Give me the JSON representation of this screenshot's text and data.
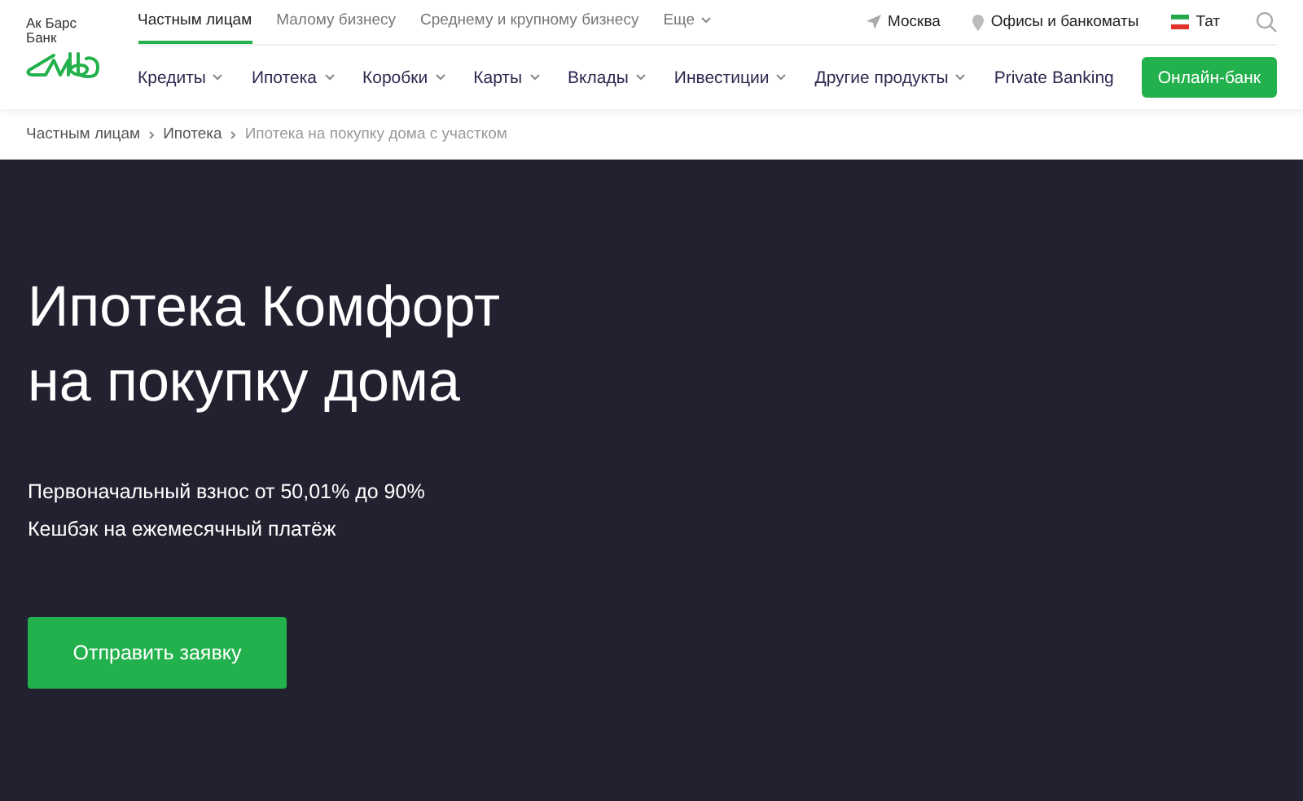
{
  "logo": {
    "line_1": "Ак Барс",
    "line_2": "Банк"
  },
  "segments": [
    {
      "label": "Частным лицам",
      "selected": true,
      "dropdown": false
    },
    {
      "label": "Малому бизнесу",
      "selected": false,
      "dropdown": false
    },
    {
      "label": "Среднему и крупному бизнесу",
      "selected": false,
      "dropdown": false
    },
    {
      "label": "Еще",
      "selected": false,
      "dropdown": true
    }
  ],
  "top_links": [
    {
      "kind": "location",
      "label": "Москва"
    },
    {
      "kind": "offices",
      "label": "Офисы и банкоматы"
    },
    {
      "kind": "language",
      "label": "Тат"
    }
  ],
  "nav": [
    {
      "label": "Кредиты",
      "dropdown": true
    },
    {
      "label": "Ипотека",
      "dropdown": true
    },
    {
      "label": "Коробки",
      "dropdown": true
    },
    {
      "label": "Карты",
      "dropdown": true
    },
    {
      "label": "Вклады",
      "dropdown": true
    },
    {
      "label": "Инвестиции",
      "dropdown": true
    },
    {
      "label": "Другие продукты",
      "dropdown": true
    },
    {
      "label": "Private Banking",
      "dropdown": false
    }
  ],
  "online_bank_button": "Онлайн-банк",
  "breadcrumbs": [
    {
      "label": "Частным лицам",
      "current": false
    },
    {
      "label": "Ипотека",
      "current": false
    },
    {
      "label": "Ипотека на покупку дома с участком",
      "current": true
    }
  ],
  "hero": {
    "title_lines": [
      "Ипотека Комфорт",
      "на покупку дома"
    ],
    "features": [
      "Первоначальный взнос от 50,01% до 90%",
      "Кешбэк на ежемесячный платёж"
    ],
    "button": "Отправить заявку"
  }
}
